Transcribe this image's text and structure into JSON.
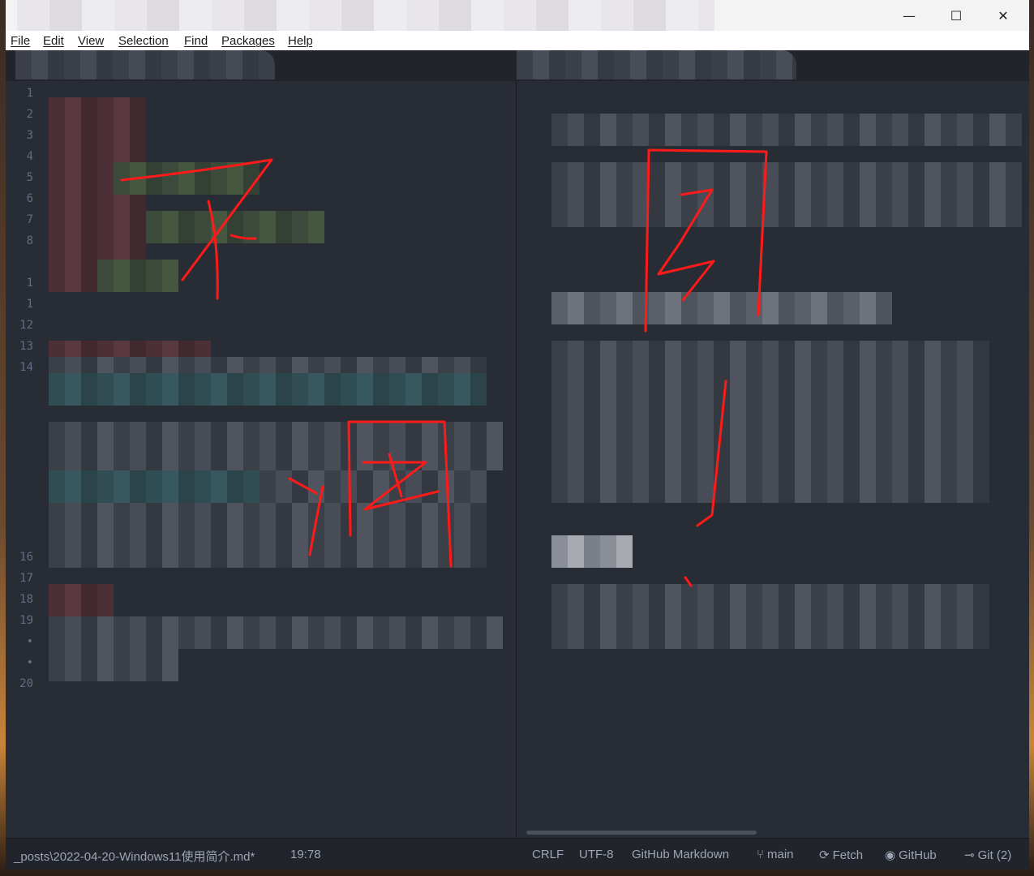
{
  "window": {
    "controls": {
      "minimize": "—",
      "maximize": "☐",
      "close": "✕"
    }
  },
  "menu": {
    "items": [
      "File",
      "Edit",
      "View",
      "Selection",
      "Find",
      "Packages",
      "Help"
    ]
  },
  "editor": {
    "gutter_lines": [
      "1",
      "2",
      "3",
      "4",
      "5",
      "6",
      "7",
      "8",
      "1",
      "1",
      "12",
      "13",
      "14",
      "16",
      "17",
      "18",
      "19",
      "•",
      "•",
      "20"
    ]
  },
  "status": {
    "file_path": "_posts\\2022-04-20-Windows11使用简介.md*",
    "cursor_position": "19:78",
    "line_ending": "CRLF",
    "encoding": "UTF-8",
    "grammar": "GitHub Markdown",
    "branch": "main",
    "fetch": "Fetch",
    "github": "GitHub",
    "git": "Git (2)",
    "icons": {
      "branch": "git-branch-icon",
      "fetch": "sync-icon",
      "github": "github-icon",
      "git": "git-commit-icon"
    }
  },
  "annotation_color": "#ff1a1a",
  "colors": {
    "editor_bg": "#282c34",
    "statusbar_bg": "#21252b",
    "menubar_bg": "#ffffff"
  }
}
